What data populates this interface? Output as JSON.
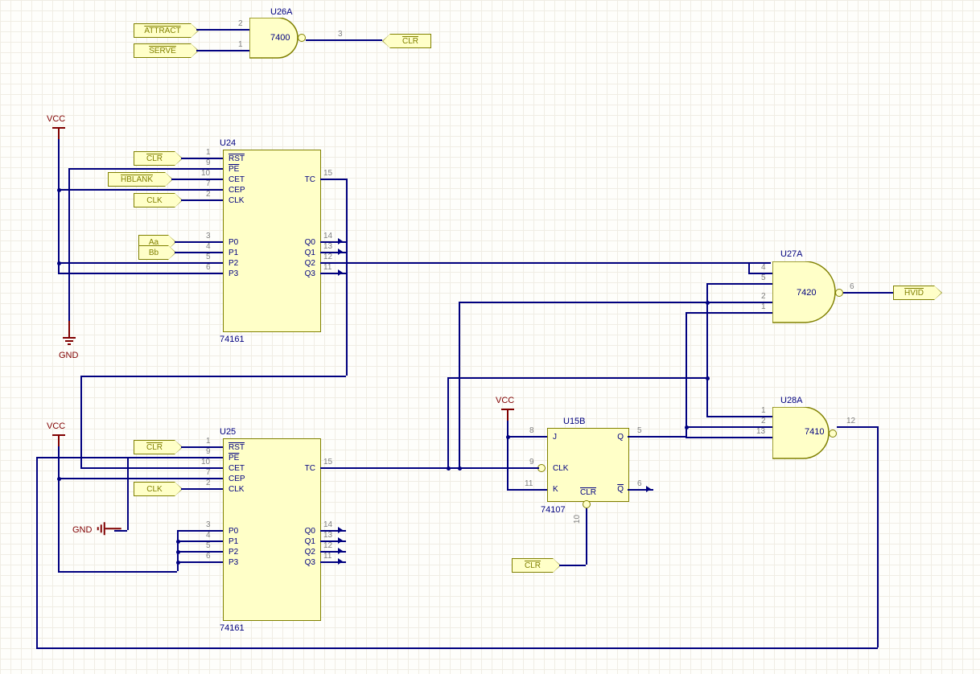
{
  "gates": {
    "u26a": {
      "des": "U26A",
      "type": "7400",
      "pins": {
        "in1": "2",
        "in2": "1",
        "out": "3"
      }
    },
    "u27a": {
      "des": "U27A",
      "type": "7420",
      "pins": {
        "in1": "4",
        "in2": "5",
        "in3": "2",
        "in4": "1",
        "out": "6"
      }
    },
    "u28a": {
      "des": "U28A",
      "type": "7410",
      "pins": {
        "in1": "1",
        "in2": "2",
        "in3": "13",
        "out": "12"
      }
    }
  },
  "chips": {
    "u24": {
      "des": "U24",
      "type": "74161",
      "left": [
        {
          "n": "1",
          "l": "RST",
          "ol": true
        },
        {
          "n": "9",
          "l": "PE",
          "ol": true
        },
        {
          "n": "10",
          "l": "CET"
        },
        {
          "n": "7",
          "l": "CEP"
        },
        {
          "n": "2",
          "l": "CLK"
        },
        {
          "n": "3",
          "l": "P0"
        },
        {
          "n": "4",
          "l": "P1"
        },
        {
          "n": "5",
          "l": "P2"
        },
        {
          "n": "6",
          "l": "P3"
        }
      ],
      "right": [
        {
          "n": "15",
          "l": "TC"
        },
        {
          "n": "14",
          "l": "Q0"
        },
        {
          "n": "13",
          "l": "Q1"
        },
        {
          "n": "12",
          "l": "Q2"
        },
        {
          "n": "11",
          "l": "Q3"
        }
      ]
    },
    "u25": {
      "des": "U25",
      "type": "74161",
      "left": [
        {
          "n": "1",
          "l": "RST",
          "ol": true
        },
        {
          "n": "9",
          "l": "PE",
          "ol": true
        },
        {
          "n": "10",
          "l": "CET"
        },
        {
          "n": "7",
          "l": "CEP"
        },
        {
          "n": "2",
          "l": "CLK"
        },
        {
          "n": "3",
          "l": "P0"
        },
        {
          "n": "4",
          "l": "P1"
        },
        {
          "n": "5",
          "l": "P2"
        },
        {
          "n": "6",
          "l": "P3"
        }
      ],
      "right": [
        {
          "n": "15",
          "l": "TC"
        },
        {
          "n": "14",
          "l": "Q0"
        },
        {
          "n": "13",
          "l": "Q1"
        },
        {
          "n": "12",
          "l": "Q2"
        },
        {
          "n": "11",
          "l": "Q3"
        }
      ]
    },
    "u15b": {
      "des": "U15B",
      "type": "74107",
      "left": [
        {
          "n": "8",
          "l": "J"
        },
        {
          "n": "9",
          "l": "CLK"
        },
        {
          "n": "11",
          "l": "K"
        }
      ],
      "right": [
        {
          "n": "5",
          "l": "Q"
        },
        {
          "n": "6",
          "l": "Q",
          "ol": true
        }
      ],
      "bottom": [
        {
          "n": "10",
          "l": "CLR",
          "ol": true
        }
      ]
    }
  },
  "tags": {
    "attract": "ATTRACT",
    "serve": "SERVE",
    "clr": "CLR",
    "hblank": "HBLANK",
    "clk": "CLK",
    "aa": "Aa",
    "bb": "Bb",
    "hvid": "HVID"
  },
  "power": {
    "vcc": "VCC",
    "gnd": "GND"
  }
}
